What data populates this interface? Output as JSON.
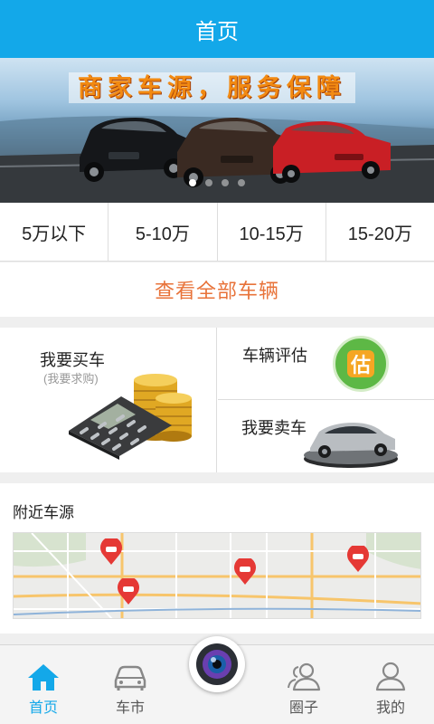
{
  "header": {
    "title": "首页"
  },
  "banner": {
    "slogan": "商家车源，服务保障",
    "slide_count": 4,
    "active_slide": 1
  },
  "price_ranges": [
    {
      "label": "5万以下"
    },
    {
      "label": "5-10万"
    },
    {
      "label": "10-15万"
    },
    {
      "label": "15-20万"
    }
  ],
  "view_all": {
    "label": "查看全部车辆"
  },
  "services": {
    "buy": {
      "title": "我要买车",
      "subtitle": "(我要求购)"
    },
    "evaluate": {
      "title": "车辆评估",
      "badge_char": "估"
    },
    "sell": {
      "title": "我要卖车"
    }
  },
  "nearby": {
    "title": "附近车源"
  },
  "tabbar": {
    "items": [
      {
        "label": "首页",
        "icon": "home-icon",
        "active": true
      },
      {
        "label": "车市",
        "icon": "car-icon",
        "active": false
      },
      {
        "label": "",
        "icon": "camera-icon",
        "active": false
      },
      {
        "label": "圈子",
        "icon": "people-icon",
        "active": false
      },
      {
        "label": "我的",
        "icon": "user-icon",
        "active": false
      }
    ]
  },
  "colors": {
    "accent": "#13a8e9",
    "orange": "#e8733a",
    "pin": "#e53935"
  }
}
